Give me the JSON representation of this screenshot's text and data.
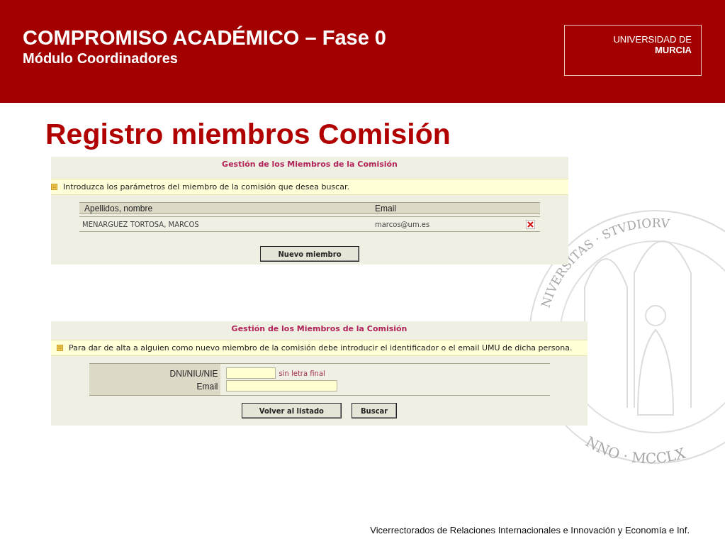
{
  "header": {
    "title": "COMPROMISO ACADÉMICO – Fase 0",
    "subtitle": "Módulo Coordinadores",
    "logo": {
      "line_1": "UNIVERSIDAD DE",
      "line_2": "MURCIA"
    }
  },
  "slide_title": "Registro miembros Comisión",
  "seal": {
    "top_text": "NIVERSITAS · STVDIORV",
    "bottom_text": "NNO · MCCLX"
  },
  "panels": [
    {
      "kind": "list",
      "title": "Gestión de los Miembros de la Comisión",
      "notice": "Introduzca los parámetros del miembro de la comisión que desea buscar.",
      "columns": [
        "Apellidos, nombre",
        "Email"
      ],
      "rows": [
        {
          "name": "MENARGUEZ TORTOSA, MARCOS",
          "email": "marcos@um.es"
        }
      ],
      "buttons": [
        "Nuevo miembro"
      ]
    },
    {
      "kind": "form",
      "title": "Gestión de los Miembros de la Comisión",
      "notice": "Para dar de alta a alguien como nuevo miembro de la comisión debe introducir el identificador o el email UMU de dicha persona.",
      "fields": [
        {
          "label": "DNI/NIU/NIE",
          "hint": "sin letra final"
        },
        {
          "label": "Email"
        }
      ],
      "buttons": [
        "Volver al listado",
        "Buscar"
      ]
    }
  ],
  "footer": "Vicerrectorados de Relaciones Internacionales e Innovación y Economía e Inf."
}
